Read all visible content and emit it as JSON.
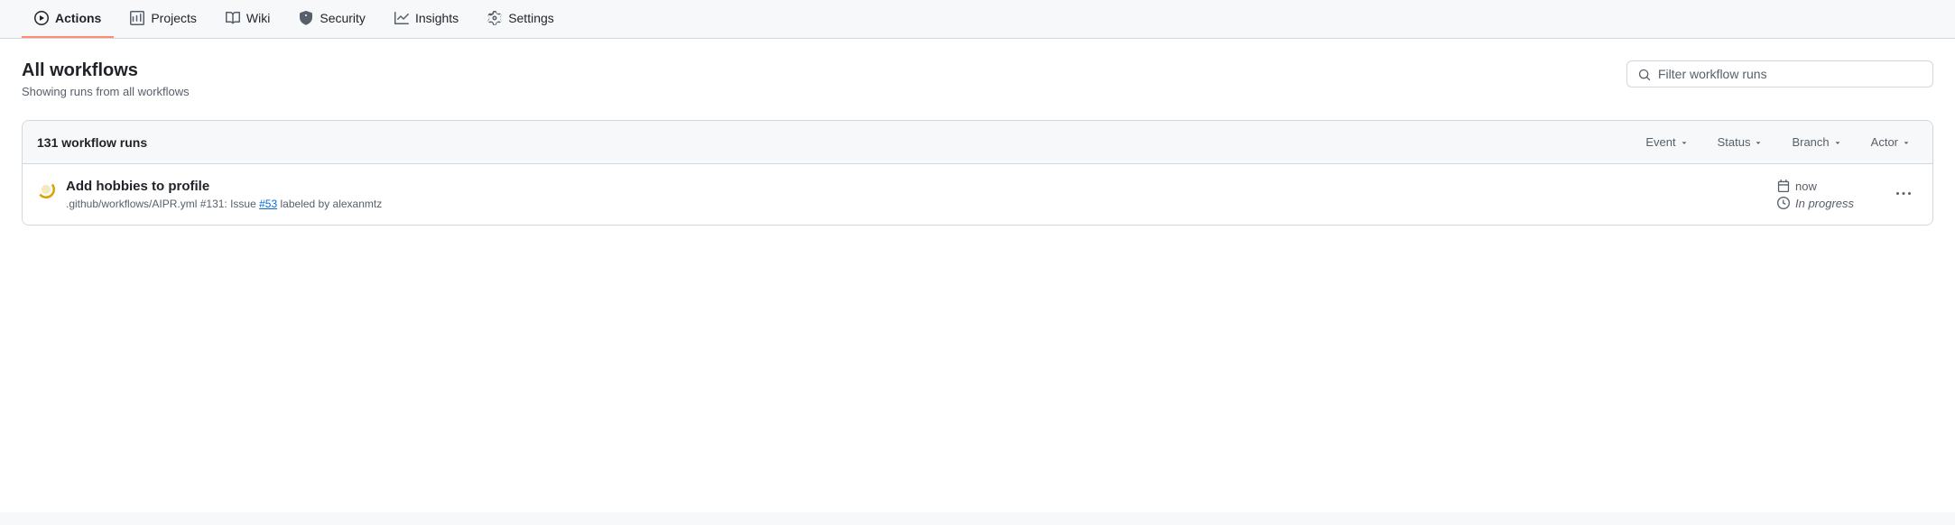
{
  "nav": {
    "tabs": [
      {
        "id": "actions",
        "label": "Actions",
        "icon": "play-icon",
        "active": true
      },
      {
        "id": "projects",
        "label": "Projects",
        "icon": "projects-icon",
        "active": false
      },
      {
        "id": "wiki",
        "label": "Wiki",
        "icon": "book-icon",
        "active": false
      },
      {
        "id": "security",
        "label": "Security",
        "icon": "shield-icon",
        "active": false
      },
      {
        "id": "insights",
        "label": "Insights",
        "icon": "graph-icon",
        "active": false
      },
      {
        "id": "settings",
        "label": "Settings",
        "icon": "gear-icon",
        "active": false
      }
    ]
  },
  "header": {
    "title": "All workflows",
    "subtitle": "Showing runs from all workflows",
    "search_placeholder": "Filter workflow runs"
  },
  "table": {
    "run_count": "131 workflow runs",
    "filters": [
      {
        "id": "event-filter",
        "label": "Event"
      },
      {
        "id": "status-filter",
        "label": "Status"
      },
      {
        "id": "branch-filter",
        "label": "Branch"
      },
      {
        "id": "actor-filter",
        "label": "Actor"
      }
    ],
    "rows": [
      {
        "id": "run-1",
        "title": "Add hobbies to profile",
        "meta_path": ".github/workflows/AIPR.yml",
        "meta_issue": "#131: Issue #53 labeled by alexanmtz",
        "meta_link_text": "#53",
        "time": "now",
        "status": "In progress",
        "status_style": "in-progress"
      }
    ]
  }
}
